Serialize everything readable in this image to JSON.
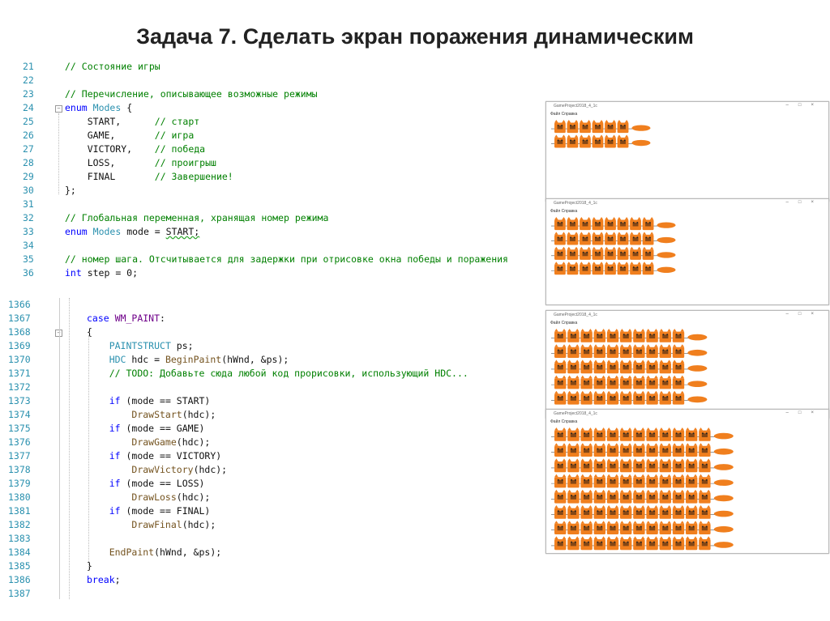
{
  "title": "Задача 7. Сделать экран поражения динамическим",
  "code_top": {
    "lines": [
      {
        "n": "21",
        "t": "// Состояние игры"
      },
      {
        "n": "22",
        "t": ""
      },
      {
        "n": "23",
        "t": "// Перечисление, описывающее возможные режимы"
      },
      {
        "n": "24",
        "t": "enum Modes {"
      },
      {
        "n": "25",
        "t": "    START,      // старт"
      },
      {
        "n": "26",
        "t": "    GAME,       // игра"
      },
      {
        "n": "27",
        "t": "    VICTORY,    // победа"
      },
      {
        "n": "28",
        "t": "    LOSS,       // проигрыш"
      },
      {
        "n": "29",
        "t": "    FINAL       // Завершение!"
      },
      {
        "n": "30",
        "t": "};"
      },
      {
        "n": "31",
        "t": ""
      },
      {
        "n": "32",
        "t": "// Глобальная переменная, хранящая номер режима"
      },
      {
        "n": "33",
        "t": "enum Modes mode = START;"
      },
      {
        "n": "34",
        "t": ""
      },
      {
        "n": "35",
        "t": "// номер шага. Отсчитывается для задержки при отрисовке окна победы и поражения"
      },
      {
        "n": "36",
        "t": "int step = 0;"
      }
    ]
  },
  "code_bottom": {
    "lines": [
      {
        "n": "1366",
        "t": ""
      },
      {
        "n": "1367",
        "t": "case WM_PAINT:"
      },
      {
        "n": "1368",
        "t": "{"
      },
      {
        "n": "1369",
        "t": "    PAINTSTRUCT ps;"
      },
      {
        "n": "1370",
        "t": "    HDC hdc = BeginPaint(hWnd, &ps);"
      },
      {
        "n": "1371",
        "t": "    // TODO: Добавьте сюда любой код прорисовки, использующий HDC..."
      },
      {
        "n": "1372",
        "t": ""
      },
      {
        "n": "1373",
        "t": "    if (mode == START)"
      },
      {
        "n": "1374",
        "t": "        DrawStart(hdc);"
      },
      {
        "n": "1375",
        "t": "    if (mode == GAME)"
      },
      {
        "n": "1376",
        "t": "        DrawGame(hdc);"
      },
      {
        "n": "1377",
        "t": "    if (mode == VICTORY)"
      },
      {
        "n": "1378",
        "t": "        DrawVictory(hdc);"
      },
      {
        "n": "1379",
        "t": "    if (mode == LOSS)"
      },
      {
        "n": "1380",
        "t": "        DrawLoss(hdc);"
      },
      {
        "n": "1381",
        "t": "    if (mode == FINAL)"
      },
      {
        "n": "1382",
        "t": "        DrawFinal(hdc);"
      },
      {
        "n": "1383",
        "t": ""
      },
      {
        "n": "1384",
        "t": "    EndPaint(hWnd, &ps);"
      },
      {
        "n": "1385",
        "t": "}"
      },
      {
        "n": "1386",
        "t": "break;"
      },
      {
        "n": "1387",
        "t": ""
      }
    ]
  },
  "windows": [
    {
      "title": "GameProject2018_4_1c",
      "menu": "Файл  Справка",
      "rows": 2,
      "cols": 6
    },
    {
      "title": "GameProject2018_4_1c",
      "menu": "Файл  Справка",
      "rows": 4,
      "cols": 8
    },
    {
      "title": "GameProject2018_4_1c",
      "menu": "Файл  Справка",
      "rows": 5,
      "cols": 10
    },
    {
      "title": "GameProject2018_4_1c",
      "menu": "Файл  Справка",
      "rows": 8,
      "cols": 12
    }
  ],
  "colors": {
    "line_number": "#2b91af",
    "comment": "#008000",
    "keyword": "#0000ff",
    "type": "#2b91af",
    "function": "#74531f",
    "macro": "#6f008a",
    "fox_orange": "#f07f1e"
  }
}
